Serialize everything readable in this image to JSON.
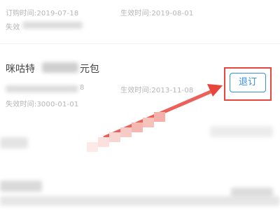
{
  "record1": {
    "order_time": "订购时间:2019-07-18",
    "effective_time": "生效时间:2019-08-01",
    "expire_prefix": "失效"
  },
  "record2": {
    "title_prefix": "咪咕特",
    "title_suffix": "元包",
    "code_tail": "8",
    "effective_time": "生效时间:2013-11-08",
    "expire_time": "失效时间:3000-01-01",
    "unsubscribe_label": "退订"
  },
  "colors": {
    "annotation": "#e8453c",
    "button": "#3a8fe0"
  },
  "icons": {
    "arrow": "annotation-arrow-icon"
  }
}
